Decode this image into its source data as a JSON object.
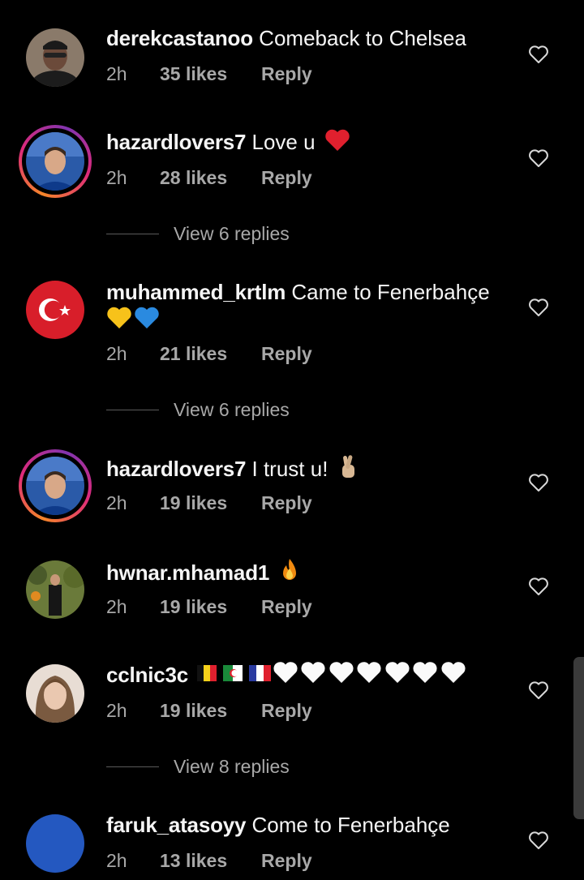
{
  "comments": [
    {
      "username": "derekcastanoo",
      "text": "Comeback to Chelsea",
      "time": "2h",
      "likes": "35 likes",
      "reply": "Reply"
    },
    {
      "username": "hazardlovers7",
      "text": "Love u",
      "time": "2h",
      "likes": "28 likes",
      "reply": "Reply",
      "view_replies": "View 6 replies"
    },
    {
      "username": "muhammed_krtlm",
      "text": "Came to Fenerbahçe",
      "time": "2h",
      "likes": "21 likes",
      "reply": "Reply",
      "view_replies": "View 6 replies"
    },
    {
      "username": "hazardlovers7",
      "text": "I trust u!",
      "time": "2h",
      "likes": "19 likes",
      "reply": "Reply"
    },
    {
      "username": "hwnar.mhamad1",
      "text": "",
      "time": "2h",
      "likes": "19 likes",
      "reply": "Reply"
    },
    {
      "username": "cclnic3c",
      "text": "",
      "time": "2h",
      "likes": "19 likes",
      "reply": "Reply",
      "view_replies": "View 8 replies"
    },
    {
      "username": "faruk_atasoyy",
      "text": "Come to Fenerbahçe",
      "time": "2h",
      "likes": "13 likes",
      "reply": "Reply"
    }
  ],
  "colors": {
    "background": "#000000",
    "meta_text": "#a8a8a8",
    "story_ring": "#dd2a7b"
  }
}
